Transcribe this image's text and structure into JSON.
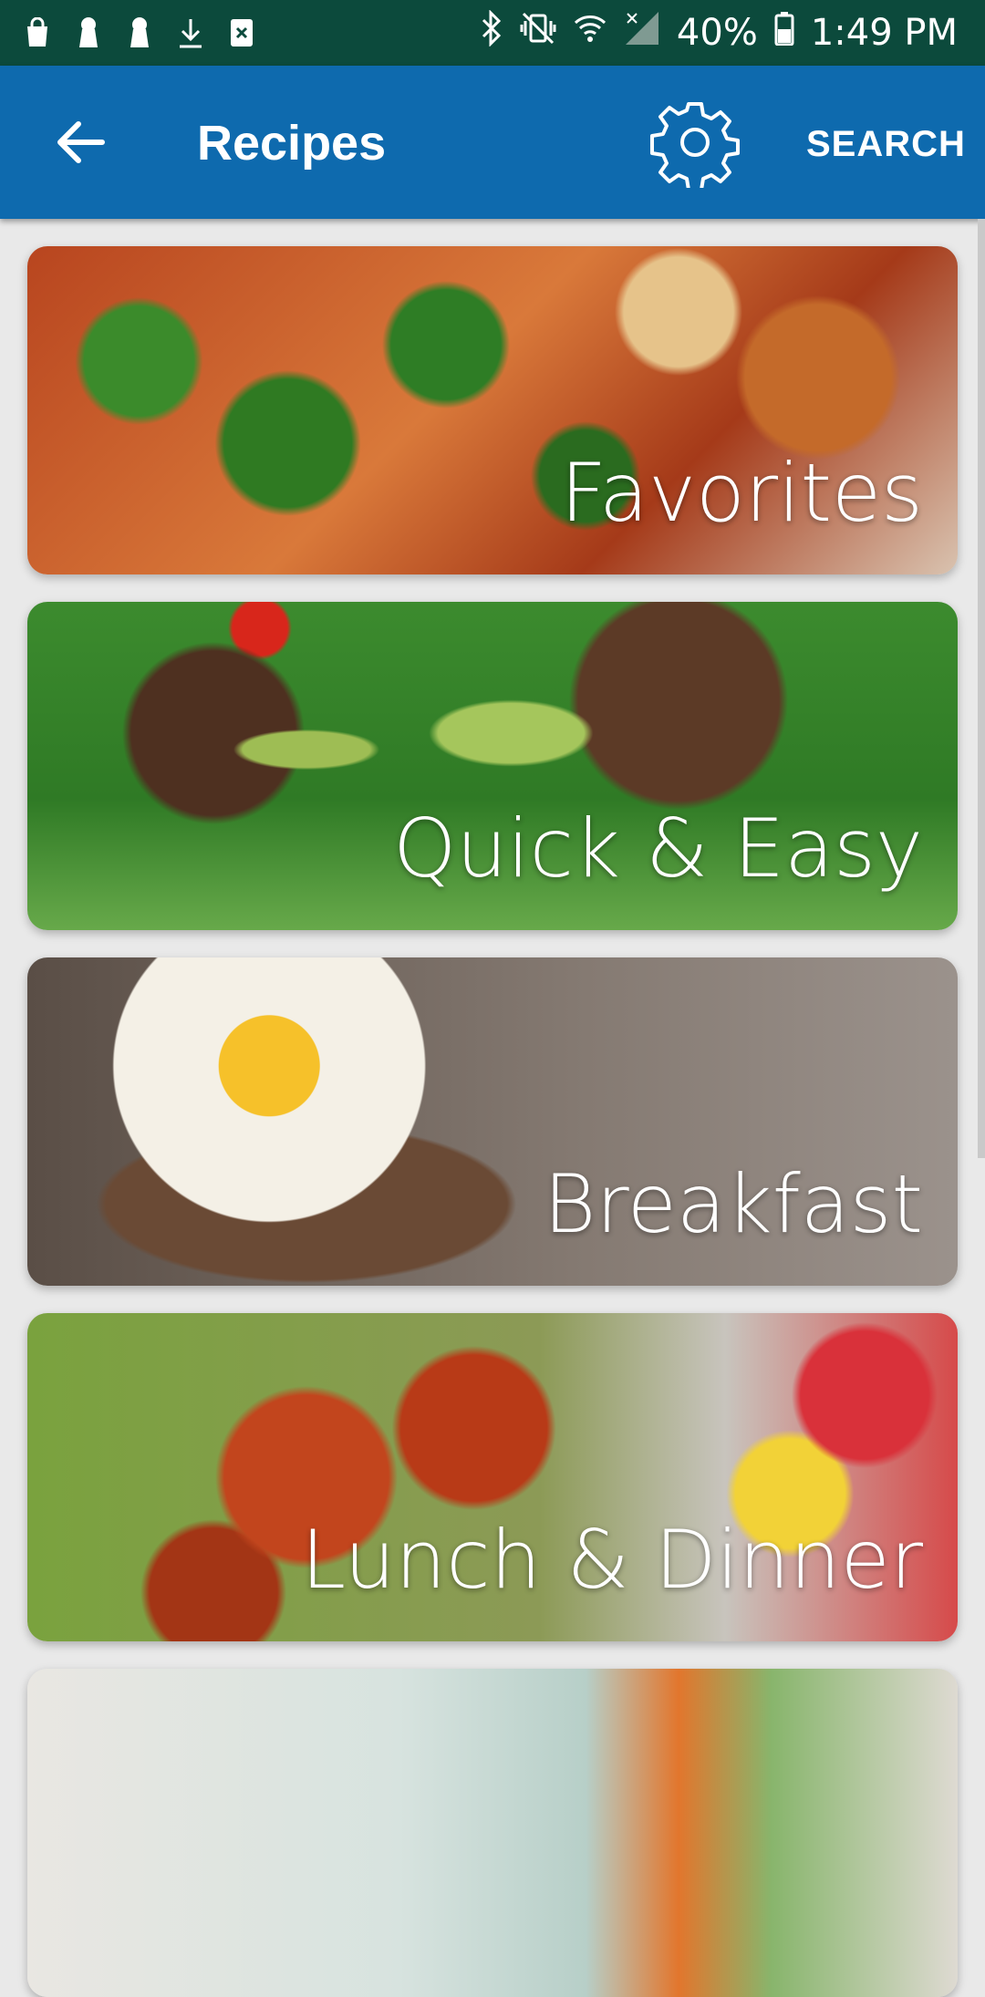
{
  "status_bar": {
    "battery_percent": "40%",
    "time": "1:49 PM",
    "left_icons": [
      "bag-icon",
      "keyhole-icon",
      "keyhole-icon",
      "download-icon",
      "card-icon"
    ],
    "right_icons": [
      "bluetooth-icon",
      "vibrate-icon",
      "wifi-icon",
      "signal-icon",
      "battery-icon"
    ]
  },
  "app_bar": {
    "title": "Recipes",
    "search_label": "SEARCH",
    "back_icon": "back-arrow-icon",
    "settings_icon": "gear-icon"
  },
  "categories": [
    {
      "label": "Favorites"
    },
    {
      "label": "Quick & Easy"
    },
    {
      "label": "Breakfast"
    },
    {
      "label": "Lunch & Dinner"
    },
    {
      "label": ""
    }
  ],
  "colors": {
    "status_bar": "#0c4a3c",
    "app_bar": "#0e6aae",
    "background": "#e9e9e9"
  }
}
